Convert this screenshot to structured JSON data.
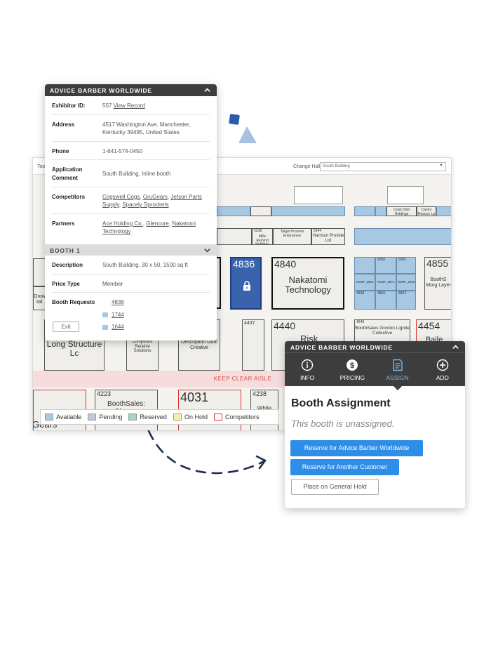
{
  "floor": {
    "toolbar_label": "Too",
    "change_hall_label": "Change Hall:",
    "hall_value": "South Building",
    "aisle_label": "KEEP CLEAR AISLE",
    "legend": [
      {
        "label": "Available",
        "color": "#a7c8e3"
      },
      {
        "label": "Pending",
        "color": "#c6c4d8"
      },
      {
        "label": "Reserved",
        "color": "#9fd8c9"
      },
      {
        "label": "On Hold",
        "color": "#f7f1a8"
      },
      {
        "label": "Competitors",
        "color": "#d9332f"
      }
    ],
    "booths": {
      "b4836": "4836",
      "b4840": "4840",
      "b4840_name": "Nakatomi Technology",
      "b4855": "4855",
      "b4855_name": "BoothS Morg Layer",
      "b4437": "4437",
      "b4440": "4440",
      "b4440_name": "Risk",
      "b4454": "4454",
      "b4454_name": "Baile",
      "b4648": "4648",
      "b4648_name": "BoothSales Gordon Lignite Collective",
      "b4223": "4223",
      "b4223_name": "BoothSales: Chavez",
      "b4031": "4031",
      "b4238": "4238",
      "b4238_name": "White",
      "long_name": "Long Structure Lc",
      "gears": "Gears",
      "grow": "Grow ital",
      "cook": "Cook Dixit Holdings",
      "castro": "Castro Reduce Lp",
      "target": "Target Process Enterprises",
      "harrison": "Harrison Provide Ltd",
      "mills": "Mills Remind Holdings",
      "b5238": "5238",
      "b5244": "5244",
      "competitor": "Competitor Receive Solutions",
      "description": "Description Goal Creative",
      "temp1": "TEMP_2854",
      "temp2": "TEMP_2871",
      "temp3": "TEMP_2846",
      "b5050": "5050",
      "b5052": "5052",
      "b4848": "4848",
      "b4850": "4850",
      "b4852": "4852"
    }
  },
  "popup1": {
    "title": "ADVICE BARBER WORLDWIDE",
    "exhibitor_label": "Exhibitor ID:",
    "exhibitor_id": "557",
    "view_record": "View Record",
    "address_label": "Address",
    "address": "4517 Washington Ave. Manchester, Kentucky 39495, United States",
    "phone_label": "Phone",
    "phone": "1-641-574-0450",
    "app_comment_label": "Application Comment",
    "app_comment": "South Building, Inline booth",
    "competitors_label": "Competitors",
    "competitors": [
      "Cogswell Cogs",
      "GruGears",
      "Jetson Parts Supply",
      "Spacely Sprockets"
    ],
    "partners_label": "Partners",
    "partners": [
      "Ace Holding Co.",
      "Glencore",
      "Nakatomi Technology"
    ],
    "booth_section": "BOOTH 1",
    "description_label": "Description",
    "description": "South Building, 30 x 50, 1500 sq ft",
    "price_label": "Price Type",
    "price": "Member",
    "requests_label": "Booth Requests",
    "requests": [
      "4836",
      "1744",
      "1644"
    ],
    "exit_label": "Exit"
  },
  "popup2": {
    "title": "ADVICE BARBER WORLDWIDE",
    "tabs": [
      "INFO",
      "PRICING",
      "ASSIGN",
      "ADD"
    ],
    "heading": "Booth Assignment",
    "subtext": "This booth is unassigned.",
    "btn_reserve_self": "Reserve for Advice Barber Worldwide",
    "btn_reserve_other": "Reserve for Another Customer",
    "btn_hold": "Place on General Hold"
  },
  "colors": {
    "accent": "#2e8de8",
    "header": "#3d3d3d",
    "selected_booth": "#3a63ad",
    "available": "#a7c8e3"
  }
}
